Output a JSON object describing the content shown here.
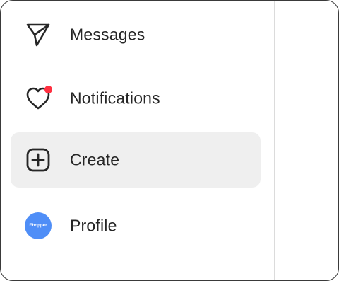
{
  "sidebar": {
    "items": [
      {
        "label": "Messages",
        "icon": "paper-plane-icon",
        "active": false
      },
      {
        "label": "Notifications",
        "icon": "heart-icon",
        "active": false,
        "has_badge": true
      },
      {
        "label": "Create",
        "icon": "plus-square-icon",
        "active": true
      },
      {
        "label": "Profile",
        "icon": "avatar",
        "active": false,
        "avatar_text": "Ehopper"
      }
    ]
  },
  "colors": {
    "text": "#262626",
    "active_background": "#efefef",
    "notification_dot": "#ff3040",
    "avatar_background": "#4f8ef7",
    "divider": "#dbdbdb"
  }
}
